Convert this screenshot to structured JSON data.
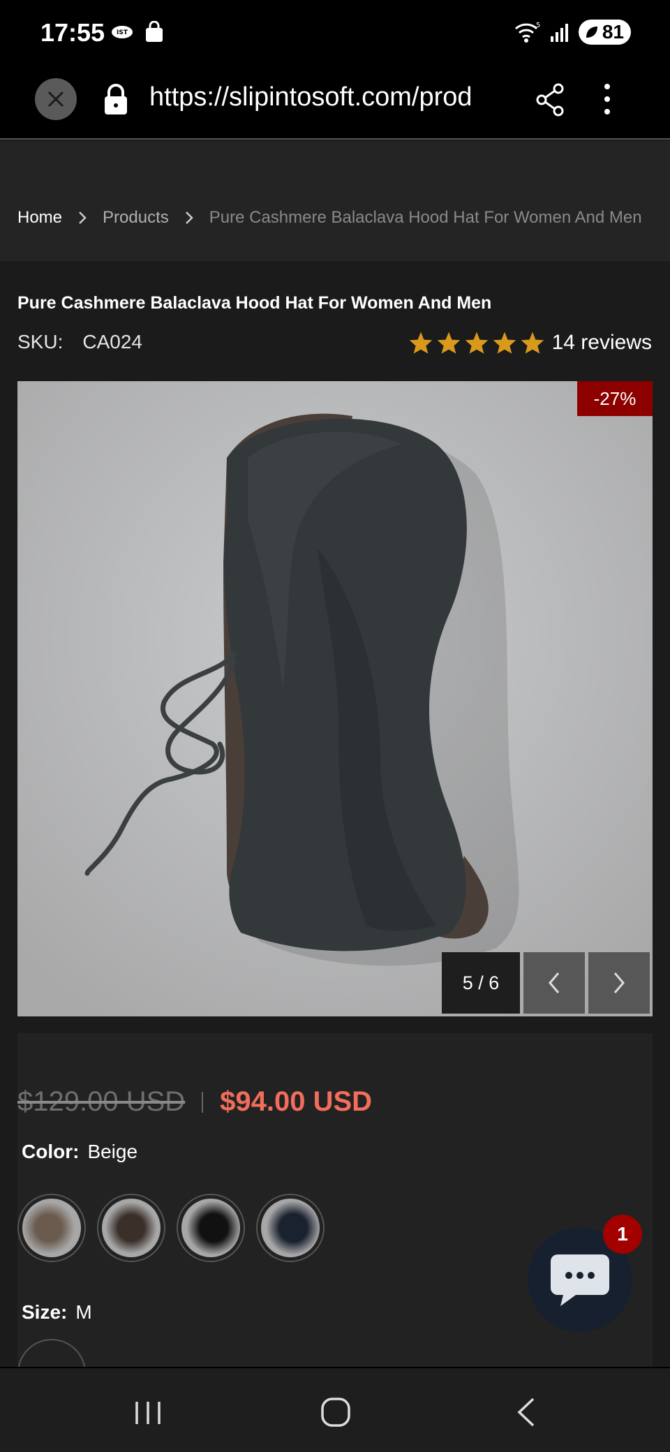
{
  "status_bar": {
    "time": "17:55",
    "battery": "81"
  },
  "browser": {
    "url": "https://slipintosoft.com/prod"
  },
  "breadcrumb": {
    "home": "Home",
    "products": "Products",
    "current": "Pure Cashmere Balaclava Hood Hat For Women And Men"
  },
  "product": {
    "title": "Pure Cashmere Balaclava Hood Hat For Women And Men",
    "sku_label": "SKU:",
    "sku_value": "CA024",
    "rating_stars": 5,
    "reviews": "14 reviews",
    "discount": "-27%",
    "slide_counter": "5 / 6",
    "price_old": "$129.00 USD",
    "price_new": "$94.00 USD",
    "color_label": "Color:",
    "color_value": "Beige",
    "size_label": "Size:",
    "size_value": "M",
    "swatches": [
      "Beige",
      "Brown",
      "Black",
      "Navy"
    ]
  },
  "chat": {
    "badge": "1"
  },
  "colors": {
    "star": "#d99a1c",
    "price_new": "#f26d5b",
    "badge": "#8c0000"
  }
}
